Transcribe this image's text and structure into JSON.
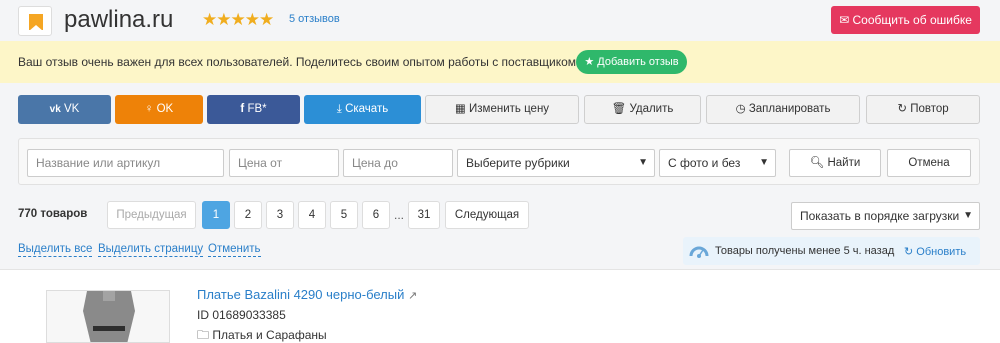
{
  "header": {
    "site_title": "pawlina.ru",
    "rating_stars": "★★★★★",
    "rating_value": 4.5,
    "reviews_link": "5 отзывов",
    "report_button": "Сообщить об ошибке",
    "report_icon": "envelope-icon"
  },
  "notice": {
    "text": "Ваш отзыв очень важен для всех пользователей. Поделитесь своим опытом работы с поставщиком.",
    "add_review_button": "Добавить отзыв",
    "add_review_icon": "star-icon"
  },
  "toolbar": {
    "buttons": [
      {
        "label": "VK",
        "icon": "vk-icon",
        "color": "#4a76a8"
      },
      {
        "label": "OK",
        "icon": "ok-icon",
        "color": "#ee8208"
      },
      {
        "label": "FB*",
        "icon": "facebook-icon",
        "color": "#3b5998"
      },
      {
        "label": "Скачать",
        "icon": "download-icon",
        "color": "#2c8fd6"
      },
      {
        "label": "Изменить цену",
        "icon": "calculator-icon"
      },
      {
        "label": "Удалить",
        "icon": "trash-icon"
      },
      {
        "label": "Запланировать",
        "icon": "clock-icon"
      },
      {
        "label": "Повтор",
        "icon": "refresh-icon"
      }
    ]
  },
  "filter": {
    "name_placeholder": "Название или артикул",
    "price_from_placeholder": "Цена от",
    "price_to_placeholder": "Цена до",
    "rubric_select": "Выберите рубрики",
    "photo_select": "С фото и без",
    "search_button": "Найти",
    "cancel_button": "Отмена"
  },
  "listing": {
    "count": "770 товаров",
    "prev": "Предыдущая",
    "pages": [
      "1",
      "2",
      "3",
      "4",
      "5",
      "6"
    ],
    "ellipsis": "...",
    "last_page": "31",
    "next": "Следующая",
    "active_page": "1",
    "sort_select": "Показать в порядке загрузки"
  },
  "selection": {
    "select_all": "Выделить все",
    "select_page": "Выделить страницу",
    "cancel": "Отменить"
  },
  "status": {
    "prefix": "Товары получены",
    "age": "менее 5 ч. назад",
    "refresh": "Обновить"
  },
  "product": {
    "title": "Платье Bazalini 4290 черно-белый",
    "id": "ID 01689033385",
    "category": "Платья и Сарафаны"
  },
  "colors": {
    "accent": "#2a7fc9",
    "danger": "#e5385f",
    "success": "#2fb86b",
    "active_page": "#4ea5e2",
    "notice_bg": "#fdf6c8"
  }
}
